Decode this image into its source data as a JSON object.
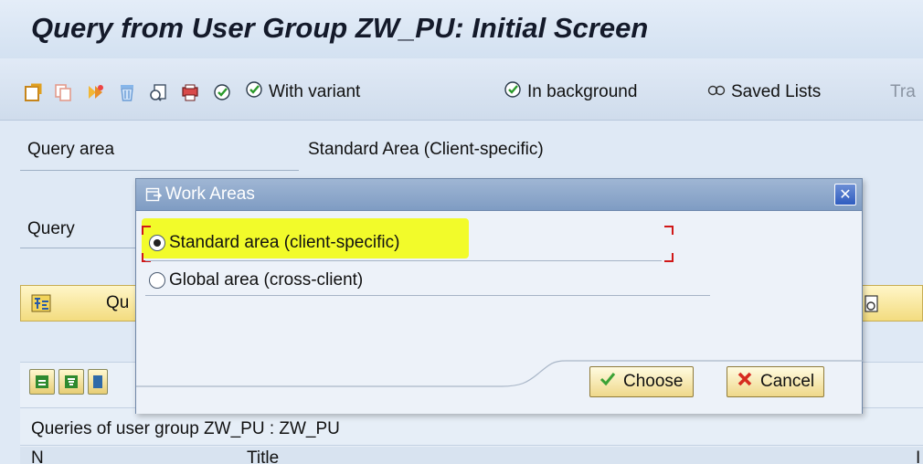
{
  "window": {
    "title": "Query from User Group ZW_PU: Initial Screen"
  },
  "toolbar": {
    "icons": [
      "change-icon",
      "copy-icon",
      "execute-icon",
      "delete-icon",
      "display-icon",
      "execute-with-variant-icon",
      "execute-clock-icon"
    ],
    "with_variant_label": "With variant",
    "in_background_label": "In background",
    "saved_lists_label": "Saved Lists",
    "truncated_label": "Tra"
  },
  "selection": {
    "query_area_label": "Query area",
    "query_area_value": "Standard Area (Client-specific)",
    "query_label": "Query",
    "query_button_label": "Qu"
  },
  "query_list": {
    "title": "Queries of user group ZW_PU : ZW_PU",
    "columns": [
      "N",
      "Title",
      "I"
    ]
  },
  "dialog": {
    "title": "Work Areas",
    "options": [
      {
        "label": "Standard area (client-specific)",
        "selected": true
      },
      {
        "label": "Global area (cross-client)",
        "selected": false
      }
    ],
    "choose_label": "Choose",
    "cancel_label": "Cancel"
  },
  "colors": {
    "highlight": "#f2fb2a",
    "dialog_titlebar": "#8aa4c8",
    "button_face": "#f4e3a0",
    "focus_frame": "#d01818"
  }
}
